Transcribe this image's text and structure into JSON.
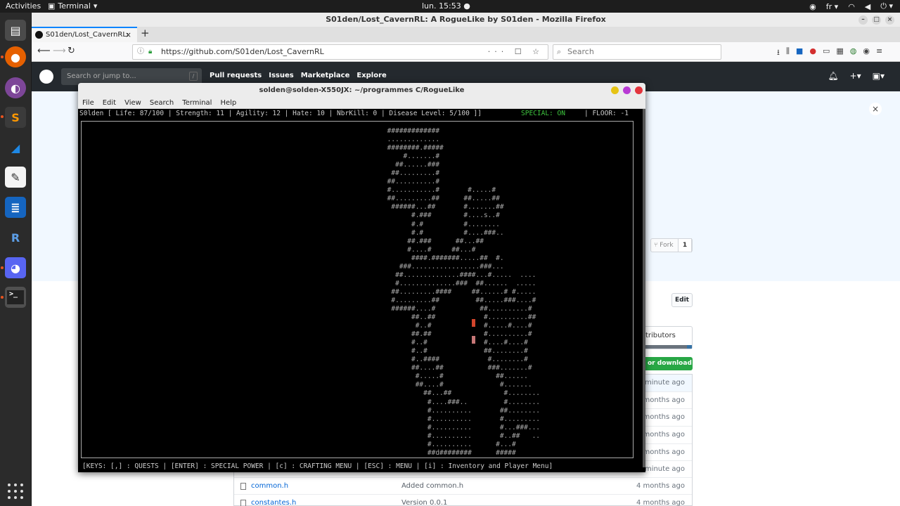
{
  "desktop": {
    "activities": "Activities",
    "app_name": "Terminal",
    "clock": "lun. 15:53",
    "lang": "fr"
  },
  "dock": {
    "apps": [
      "files-icon",
      "firefox-icon",
      "tor-browser-icon",
      "sublime-text-icon",
      "wireshark-icon",
      "text-editor-icon",
      "libreoffice-writer-icon",
      "rstudio-icon",
      "discord-icon",
      "terminal-icon"
    ]
  },
  "browser": {
    "window_title": "S01den/Lost_CavernRL: A RogueLike by S01den - Mozilla Firefox",
    "tab_title": "S01den/Lost_CavernRL:",
    "url": "https://github.com/S01den/Lost_CavernRL",
    "search_placeholder": "Search"
  },
  "github": {
    "search_placeholder": "Search or jump to...",
    "search_shortcut": "/",
    "nav": [
      "Pull requests",
      "Issues",
      "Marketplace",
      "Explore"
    ],
    "fork_label": "Fork",
    "fork_count": "1",
    "edit_label": "Edit",
    "contributors_label": "tributors",
    "download_label": "or download",
    "files": [
      {
        "name": "",
        "message": "",
        "age": "1 minute ago"
      },
      {
        "name": "",
        "message": "",
        "age": "4 months ago"
      },
      {
        "name": "",
        "message": "",
        "age": "4 months ago"
      },
      {
        "name": "",
        "message": "",
        "age": "4 months ago"
      },
      {
        "name": "",
        "message": "",
        "age": "4 months ago"
      },
      {
        "name": "",
        "message": "",
        "age": "1 minute ago"
      },
      {
        "name": "common.h",
        "message": "Added common.h",
        "age": "4 months ago"
      },
      {
        "name": "constantes.h",
        "message": "Version 0.0.1",
        "age": "4 months ago"
      }
    ]
  },
  "terminal": {
    "title": "solden@solden-X550JX: ~/programmes C/RogueLike",
    "menu": [
      "File",
      "Edit",
      "View",
      "Search",
      "Terminal",
      "Help"
    ],
    "status_line": "S0lden [ Life: 87/100 | Strength: 11 | Agility: 12 | Hate: 10 | NbrKill: 0 | Disease Level: 5/100 ]]",
    "special": "SPECIAL: ON",
    "floor": "| FLOOR: -1",
    "keys_line": "[KEYS: [,] : QUESTS | [ENTER] : SPECIAL POWER | [c] : CRAFTING MENU | [ESC] : MENU | [i] : Inventory and Player Menu]",
    "map": "                                                                            #############\n                                                                            .............\n                                                                            ########.#####\n                                                                                #.......#\n                                                                              ##......###\n                                                                             ##.........#\n                                                                            ##..........#\n                                                                            #...........#       #.....#\n                                                                            ##.........##      ##.....##\n                                                                             ######...##       #.......##\n                                                                                  #.###        #....s..#\n                                                                                  #.#          #........\n                                                                                  #.#          #....###..\n                                                                                 ##.###      ##...##\n                                                                                 #....#     ##...#\n                                                                                  ####.#######.....##  #.\n                                                                               ###.................###...\n                                                                              ##..............####...#.....  ....\n                                                                              #..............###  ##......  .....\n                                                                             ##.........####     ##......# #.....\n                                                                             #.........##         ##.....###....#\n                                                                             ######....#           ##..........#\n                                                                                  ##..##            #..........##\n                                                                                   #..#             #.....#....#\n                                                                                  ##.##             #..........#\n                                                                                  #..#              #....#....#\n                                                                                  #..#              ##........#\n                                                                                  #..####            #........#\n                                                                                  ##....##           ###.......#\n                                                                                   #.....#             ##......\n                                                                                   ##....#              #.......\n                                                                                     ##...##             #........\n                                                                                      #....###..         #........\n                                                                                      #..........       ##........\n                                                                                      #..........       #.........\n                                                                                      #..........       #...###...\n                                                                                      #..........       #..##   ..\n                                                                                      #..........      #...#\n                                                                                      ##d########      #####"
  }
}
